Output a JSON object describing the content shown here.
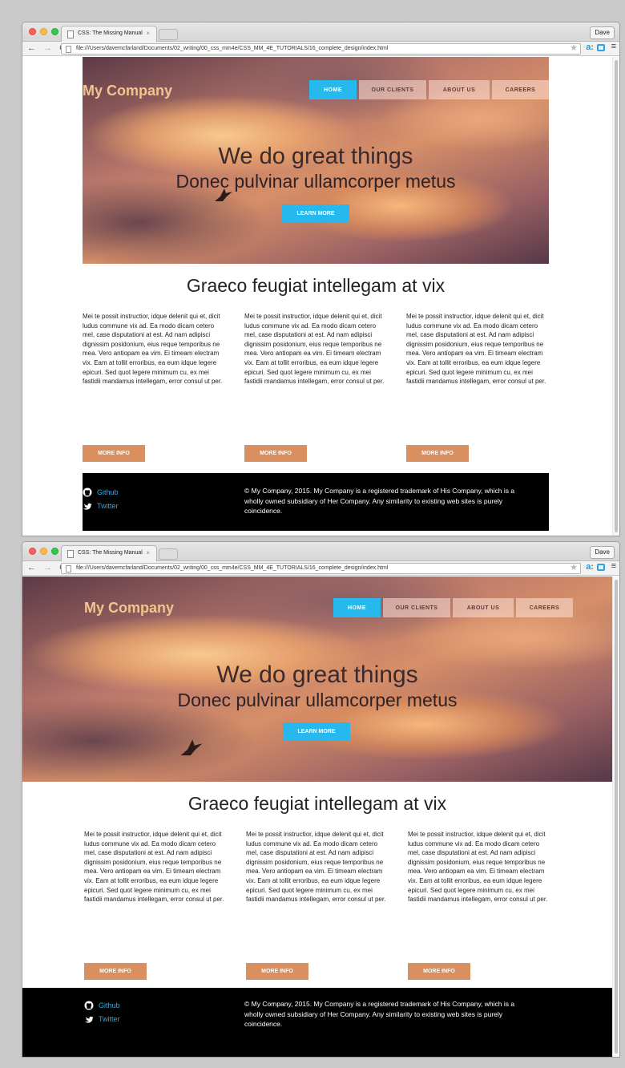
{
  "browser": {
    "tab_title": "CSS: The Missing Manual",
    "tab_close": "×",
    "user_button": "Dave",
    "back_arrow": "←",
    "forward_arrow": "→",
    "reload": "C",
    "url": "file:///Users/davemcfarland/Documents/02_writing/00_css_mm4e/CSS_MM_4E_TUTORIALS/16_complete_design/index.html",
    "star": "★",
    "ext_amazon": "a:",
    "menu": "≡"
  },
  "site": {
    "logo": "My Company",
    "nav": {
      "home": "HOME",
      "clients": "OUR CLIENTS",
      "about": "ABOUT US",
      "careers": "CAREERS"
    },
    "hero_title": "We do great things",
    "hero_subtitle": "Donec pulvinar ullamcorper metus",
    "learn_more": "LEARN MORE",
    "section_title": "Graeco feugiat intellegam at vix",
    "column_text": "Mei te possit instructior, idque delenit qui et, dicit ludus commune vix ad. Ea modo dicam cetero mel, case disputationi at est. Ad nam adipisci dignissim posidonium, eius reque temporibus ne mea. Vero antiopam ea vim. Ei timeam electram vix. Eam at tollit erroribus, ea eum idque legere epicuri. Sed quot legere minimum cu, ex mei fastidii mandamus intellegam, error consul ut per.",
    "more_info": "MORE INFO",
    "footer": {
      "github": "Github",
      "twitter": "Twitter",
      "copyright": "© My Company, 2015. My Company is a registered trademark of His Company, which is a wholly owned subsidiary of Her Company. Any similarity to existing web sites is purely coincidence."
    }
  },
  "colors": {
    "accent_blue": "#27b9ee",
    "button_orange": "#d98f5f",
    "logo_peach": "#f3c58e",
    "footer_link_blue": "#2ea9e6"
  }
}
